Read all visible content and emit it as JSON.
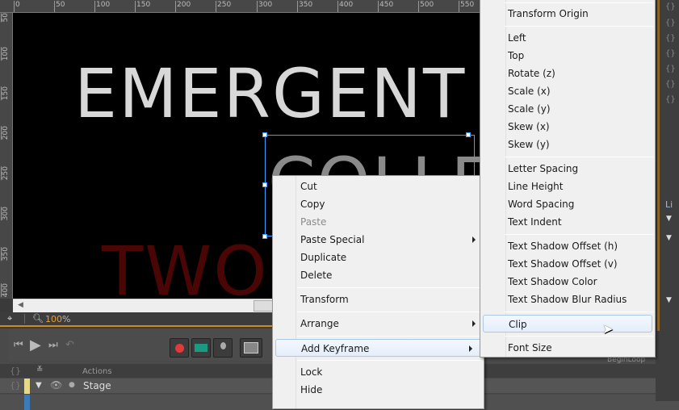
{
  "ruler": {
    "top": [
      "0",
      "50",
      "100",
      "150",
      "200",
      "250",
      "300",
      "350",
      "400",
      "450",
      "500",
      "550"
    ],
    "left": [
      "50",
      "100",
      "150",
      "200",
      "250",
      "300",
      "350",
      "400"
    ]
  },
  "stage": {
    "line1": "EMERGENT",
    "line2": "COLLE",
    "line3": "TWO",
    "colors": {
      "line1": "#d8d8d8",
      "line2": "#8a8a8a",
      "line3": "#4a0505"
    }
  },
  "status": {
    "zoom_value": "100",
    "zoom_unit": "%"
  },
  "timeline": {
    "header_label": "Actions",
    "rows": [
      {
        "label": "Stage",
        "color": "#e6d98a"
      },
      {
        "label": "",
        "color": "#3c7bb8"
      }
    ],
    "marker": "BeginLoop"
  },
  "context_menu": {
    "items": [
      "Cut",
      "Copy",
      "Paste",
      "Paste Special",
      "Duplicate",
      "Delete",
      "Transform",
      "Arrange",
      "Add Keyframe",
      "Lock",
      "Hide"
    ]
  },
  "submenu": {
    "items": [
      "Transform Origin",
      "Left",
      "Top",
      "Rotate (z)",
      "Scale (x)",
      "Scale (y)",
      "Skew (x)",
      "Skew (y)",
      "Letter Spacing",
      "Line Height",
      "Word Spacing",
      "Text Indent",
      "Text Shadow Offset (h)",
      "Text Shadow Offset (v)",
      "Text Shadow Color",
      "Text Shadow Blur Radius",
      "Clip",
      "Font Size"
    ]
  },
  "right_panel": {
    "tab_label": "Li"
  },
  "accent": "#d08a20"
}
